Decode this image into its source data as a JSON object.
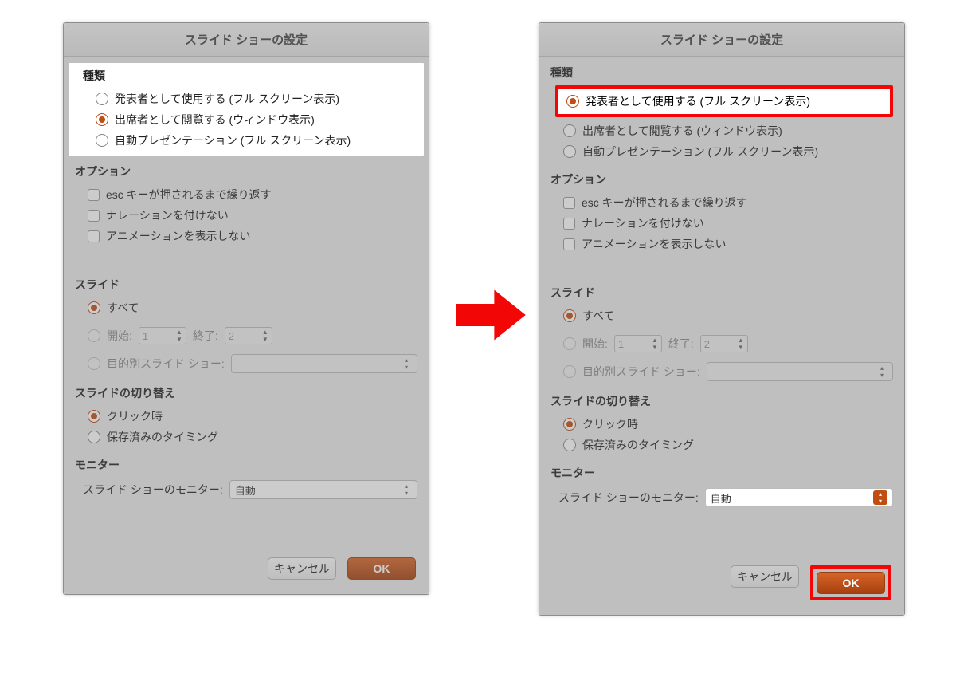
{
  "dialog": {
    "title": "スライド ショーの設定",
    "sections": {
      "type": {
        "title": "種類",
        "option_presenter": "発表者として使用する (フル スクリーン表示)",
        "option_attendee": "出席者として閲覧する (ウィンドウ表示)",
        "option_auto": "自動プレゼンテーション (フル スクリーン表示)"
      },
      "options": {
        "title": "オプション",
        "loop_until_esc": "esc キーが押されるまで繰り返す",
        "no_narration": "ナレーションを付けない",
        "no_animation": "アニメーションを表示しない"
      },
      "slides": {
        "title": "スライド",
        "all": "すべて",
        "from_label": "開始:",
        "from_value": "1",
        "to_label": "終了:",
        "to_value": "2",
        "custom_show": "目的別スライド ショー:"
      },
      "advance": {
        "title": "スライドの切り替え",
        "on_click": "クリック時",
        "use_timings": "保存済みのタイミング"
      },
      "monitor": {
        "title": "モニター",
        "monitor_label": "スライド ショーのモニター:",
        "monitor_value": "自動"
      }
    },
    "buttons": {
      "cancel": "キャンセル",
      "ok": "OK"
    }
  },
  "left_state": {
    "type_selected": "attendee"
  },
  "right_state": {
    "type_selected": "presenter"
  },
  "colors": {
    "accent": "#c04d12",
    "highlight_red": "#f20606"
  }
}
